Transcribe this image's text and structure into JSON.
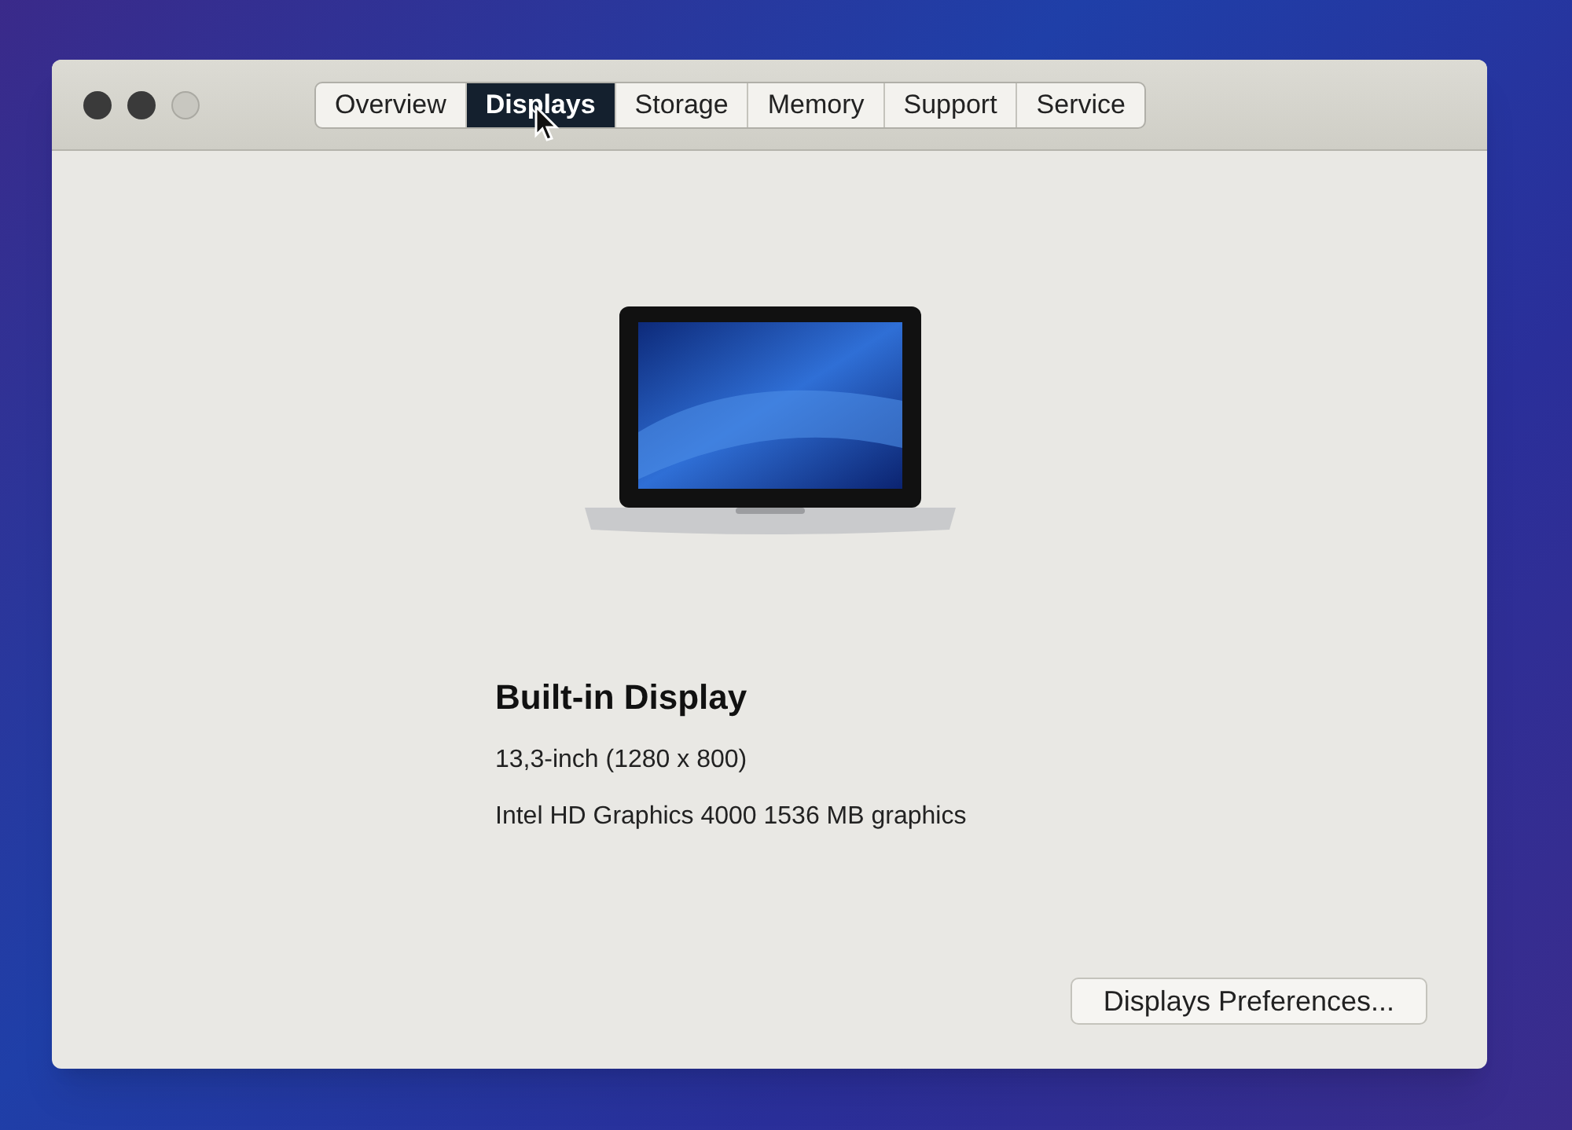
{
  "tabs": [
    {
      "label": "Overview",
      "selected": false
    },
    {
      "label": "Displays",
      "selected": true
    },
    {
      "label": "Storage",
      "selected": false
    },
    {
      "label": "Memory",
      "selected": false
    },
    {
      "label": "Support",
      "selected": false
    },
    {
      "label": "Service",
      "selected": false
    }
  ],
  "display": {
    "title": "Built-in Display",
    "size": "13,3-inch (1280 x 800)",
    "graphics": "Intel HD Graphics 4000 1536 MB graphics"
  },
  "button": "Displays Preferences..."
}
